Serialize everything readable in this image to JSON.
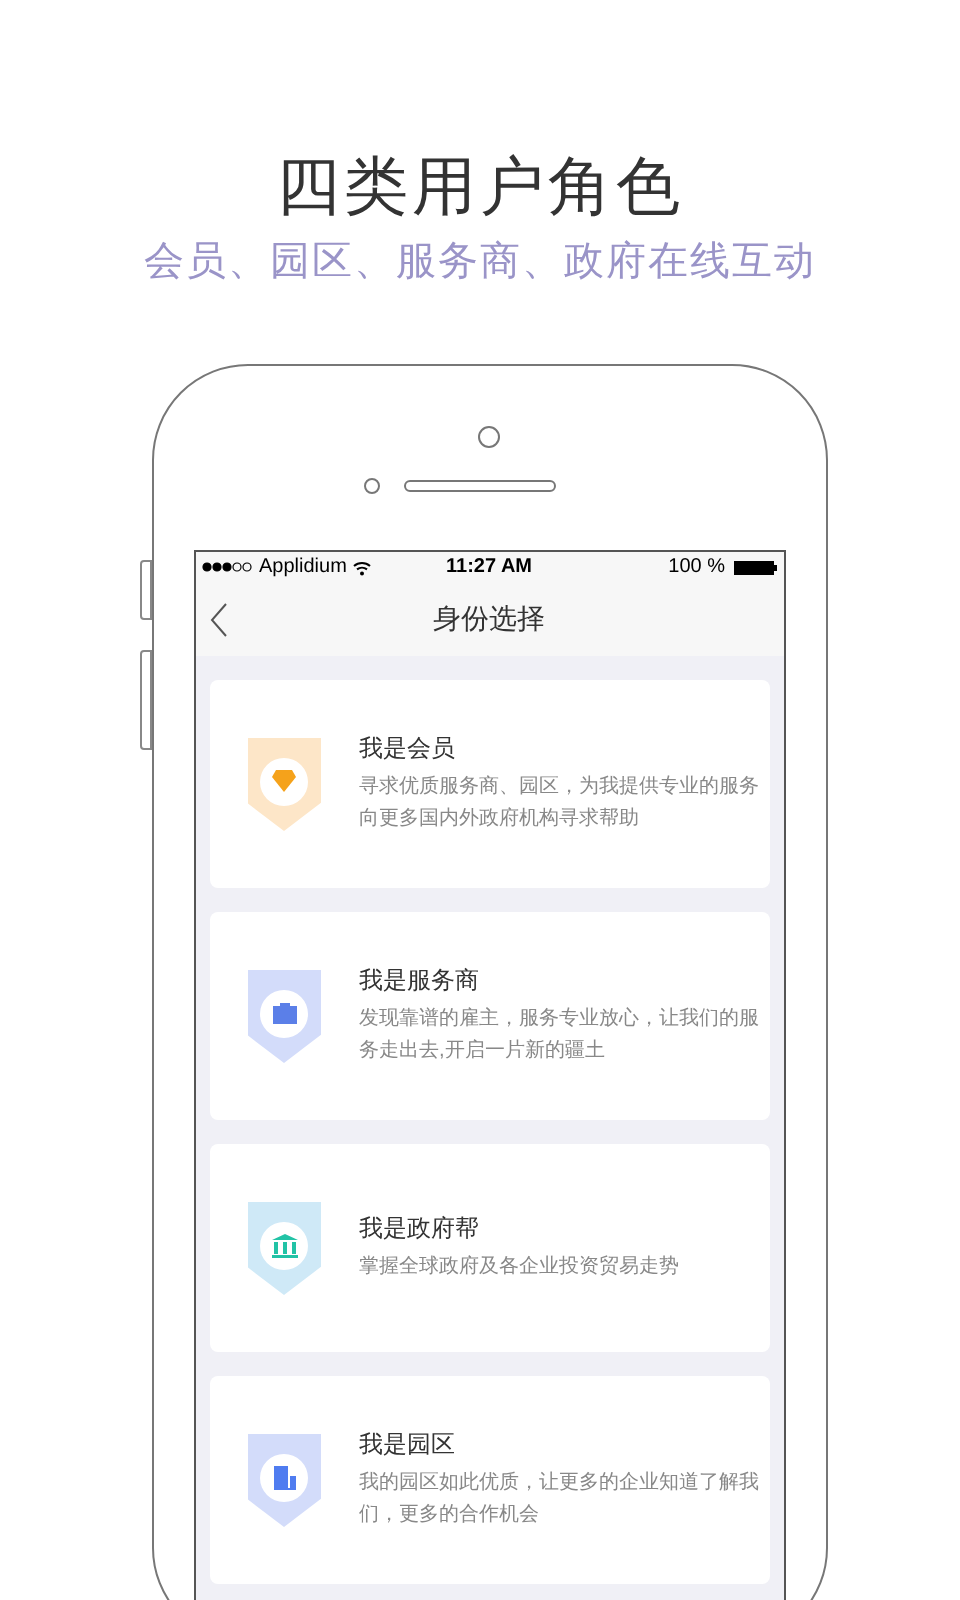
{
  "heading": {
    "title": "四类用户角色",
    "subtitle": "会员、园区、服务商、政府在线互动"
  },
  "status_bar": {
    "carrier": "Applidium",
    "time": "11:27 AM",
    "battery": "100 %"
  },
  "nav": {
    "title": "身份选择"
  },
  "roles": [
    {
      "kind": "diamond",
      "color": "#fde6c8",
      "title": "我是会员",
      "description": "寻求优质服务商、园区，为我提供专业的服务向更多国内外政府机构寻求帮助"
    },
    {
      "kind": "briefcase",
      "color": "#d3dcfa",
      "title": "我是服务商",
      "description": "发现靠谱的雇主，服务专业放心，让我们的服务走出去,开启一片新的疆土"
    },
    {
      "kind": "bank",
      "color": "#cfe9f7",
      "title": "我是政府帮",
      "description": "掌握全球政府及各企业投资贸易走势"
    },
    {
      "kind": "building",
      "color": "#d3dcfa",
      "title": "我是园区",
      "description": "我的园区如此优质，让更多的企业知道了解我们，更多的合作机会"
    }
  ]
}
